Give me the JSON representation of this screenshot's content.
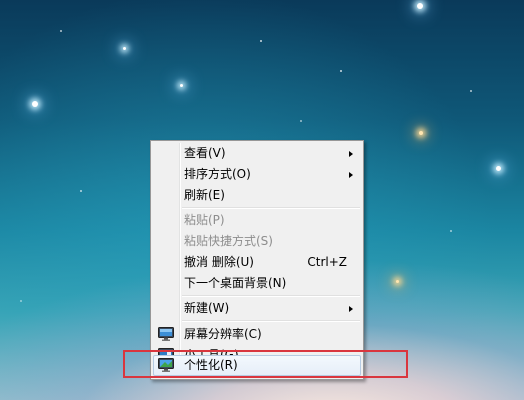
{
  "context_menu": {
    "items": [
      {
        "label": "查看(V)",
        "submenu": true
      },
      {
        "label": "排序方式(O)",
        "submenu": true
      },
      {
        "label": "刷新(E)"
      },
      {
        "label": "粘贴(P)",
        "disabled": true
      },
      {
        "label": "粘贴快捷方式(S)",
        "disabled": true
      },
      {
        "label": "撤消 删除(U)",
        "shortcut": "Ctrl+Z"
      },
      {
        "label": "下一个桌面背景(N)"
      },
      {
        "label": "新建(W)",
        "submenu": true
      },
      {
        "label": "屏幕分辨率(C)",
        "icon": "display-resolution-icon"
      },
      {
        "label": "小工具(G)",
        "icon": "gadgets-icon"
      },
      {
        "label": "个性化(R)",
        "icon": "personalize-icon",
        "highlighted": true
      }
    ]
  },
  "colors": {
    "menu_background": "#f0f0f0",
    "annotation_box": "#d9363e"
  }
}
